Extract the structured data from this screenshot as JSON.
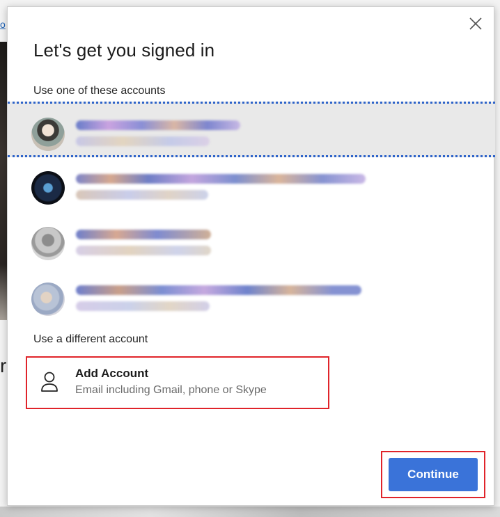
{
  "background": {
    "link_fragment": "o",
    "letter_fragment": "r"
  },
  "dialog": {
    "title": "Let's get you signed in",
    "close_icon": "close-icon",
    "use_one_label": "Use one of these accounts",
    "use_different_label": "Use a different account",
    "accounts_note": "Account names and emails are blurred/redacted in the screenshot",
    "add_account": {
      "title": "Add Account",
      "subtitle": "Email including Gmail, phone or Skype",
      "icon": "person-icon"
    },
    "continue_label": "Continue"
  },
  "colors": {
    "accent": "#3a73d9",
    "highlight_box": "#e0242a",
    "selected_row": "#e9e9e9",
    "focus_dots": "#2d63c9"
  }
}
